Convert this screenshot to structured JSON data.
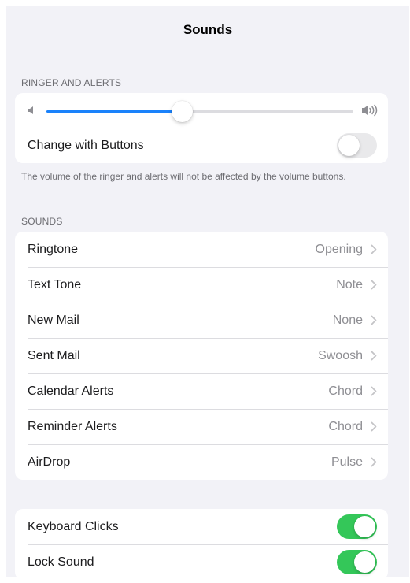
{
  "nav": {
    "title": "Sounds"
  },
  "ringer": {
    "header": "RINGER AND ALERTS",
    "volume_fraction": 0.44,
    "change_with_buttons": {
      "label": "Change with Buttons",
      "on": false
    },
    "footer": "The volume of the ringer and alerts will not be affected by the volume buttons."
  },
  "sounds": {
    "header": "SOUNDS",
    "items": [
      {
        "label": "Ringtone",
        "value": "Opening"
      },
      {
        "label": "Text Tone",
        "value": "Note"
      },
      {
        "label": "New Mail",
        "value": "None"
      },
      {
        "label": "Sent Mail",
        "value": "Swoosh"
      },
      {
        "label": "Calendar Alerts",
        "value": "Chord"
      },
      {
        "label": "Reminder Alerts",
        "value": "Chord"
      },
      {
        "label": "AirDrop",
        "value": "Pulse"
      }
    ]
  },
  "toggles": {
    "keyboard_clicks": {
      "label": "Keyboard Clicks",
      "on": true
    },
    "lock_sound": {
      "label": "Lock Sound",
      "on": true
    }
  },
  "colors": {
    "accent": "#1a82fb",
    "toggle_on": "#34c759",
    "background": "#f2f2f7",
    "secondary_text": "#8e8e93"
  },
  "icons": [
    "speaker-low-icon",
    "speaker-high-icon",
    "chevron-right-icon"
  ]
}
